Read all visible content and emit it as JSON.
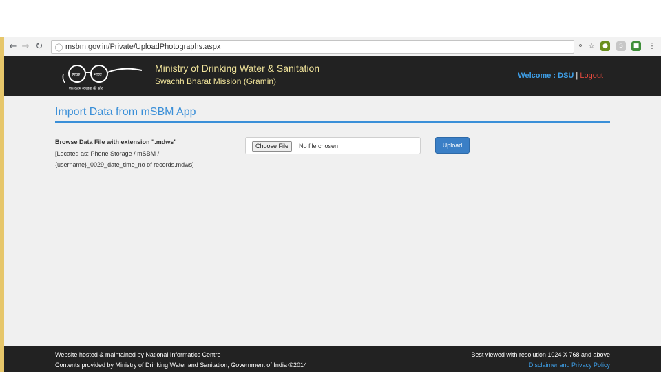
{
  "browser": {
    "url": "msbm.gov.in/Private/UploadPhotographs.aspx",
    "back_icon": "arrow-left-icon",
    "forward_icon": "arrow-right-icon",
    "reload_icon": "reload-icon",
    "info_icon": "info-icon",
    "bookmark_icon": "star-icon",
    "menu_icon": "kebab-menu-icon"
  },
  "header": {
    "ministry": "Ministry of Drinking Water & Sanitation",
    "mission": "Swachh Bharat Mission (Gramin)",
    "welcome_label": "Welcome : DSU",
    "separator": "|",
    "logout_label": "Logout",
    "logo_tagline": "एक कदम स्वच्छता की ओर",
    "logo_word_left": "स्वच्छ",
    "logo_word_right": "भारत"
  },
  "main": {
    "title": "Import Data from mSBM App",
    "browse_label": "Browse Data File with extension \".mdws\"",
    "hint_line1": "[Located as: Phone Storage / mSBM /",
    "hint_line2": "{username}_0029_date_time_no of records.mdws]",
    "choose_file_label": "Choose File",
    "no_file_text": "No file chosen",
    "upload_label": "Upload"
  },
  "footer": {
    "hosted": "Website hosted & maintained by National Informatics Centre",
    "contents": "Contents provided by Ministry of Drinking Water and Sanitation, Government of India ©2014",
    "best_viewed": "Best viewed with resolution 1024 X 768 and above",
    "disclaimer": "Disclaimer and Privacy Policy"
  },
  "colors": {
    "header_bg": "#222222",
    "accent_blue": "#3a8fd8",
    "ministry_text": "#f0e39a",
    "logout_red": "#e84a3e",
    "upload_button": "#3a7fc6"
  }
}
